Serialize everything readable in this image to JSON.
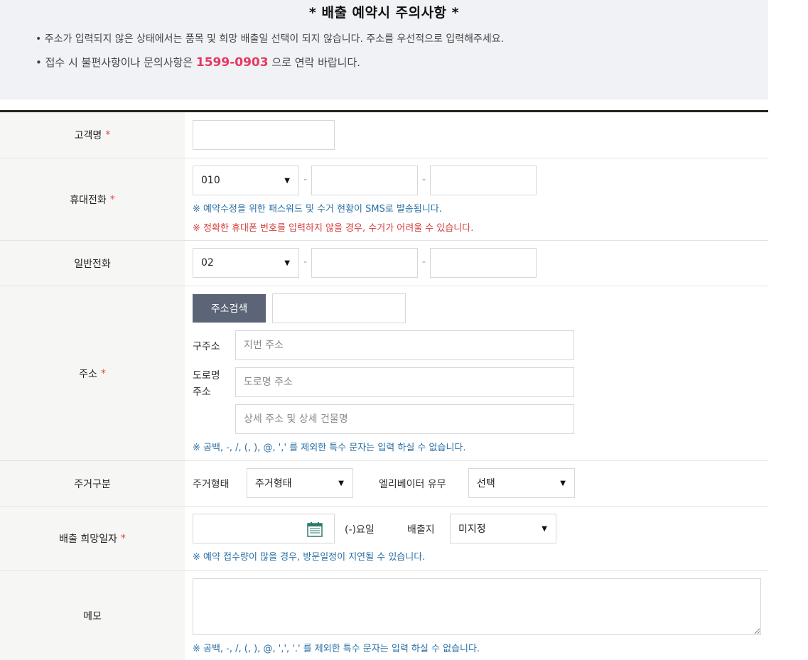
{
  "notice": {
    "title": "* 배출 예약시 주의사항 *",
    "line1": "• 주소가 입력되지 않은 상태에서는 품목 및 희망 배출일 선택이 되지 않습니다. 주소를 우선적으로 입력해주세요.",
    "line2_prefix": "• 접수 시 불편사항이나 문의사항은 ",
    "phone": "1599-0903",
    "line2_suffix": " 으로 연락 바랍니다."
  },
  "form": {
    "required_mark": "*",
    "customer": {
      "label": "고객명",
      "value": ""
    },
    "mobile": {
      "label": "휴대전화",
      "prefix": "010",
      "dash": "-",
      "note1": "※ 예약수정을 위한 패스워드 및 수거 현황이 SMS로 발송됩니다.",
      "note2": "※ 정확한 휴대폰 번호를 입력하지 않을 경우, 수거가 어려울 수 있습니다."
    },
    "landline": {
      "label": "일반전화",
      "prefix": "02",
      "dash": "-"
    },
    "address": {
      "label": "주소",
      "search_button": "주소검색",
      "old_label": "구주소",
      "old_placeholder": "지번 주소",
      "road_label_1": "도로명",
      "road_label_2": "주소",
      "road_placeholder": "도로명 주소",
      "detail_placeholder": "상세 주소 및 상세 건물명",
      "note": "※ 공백, -, /, (, ), @, ',' 를 제외한 특수 문자는 입력 하실 수 없습니다."
    },
    "residence": {
      "label": "주거구분",
      "type_label": "주거형태",
      "type_value": "주거형태",
      "elevator_label": "엘리베이터 유무",
      "elevator_value": "선택"
    },
    "date": {
      "label": "배출 희망일자",
      "weekday": "(-)요일",
      "place_label": "배출지",
      "place_value": "미지정",
      "note": "※ 예약 접수량이 많을 경우, 방문일정이 지연될 수 있습니다."
    },
    "memo": {
      "label": "메모",
      "note": "※ 공백, -, /, (, ), @, ',', '.' 를 제외한 특수 문자는 입력 하실 수 없습니다."
    }
  },
  "colors": {
    "accent_phone": "#e8375f",
    "note_blue": "#2a6fa5",
    "note_red": "#d63b3b",
    "search_button": "#5b6577"
  },
  "icons": {
    "select_arrow": "triangle-down-icon",
    "calendar": "calendar-icon"
  }
}
